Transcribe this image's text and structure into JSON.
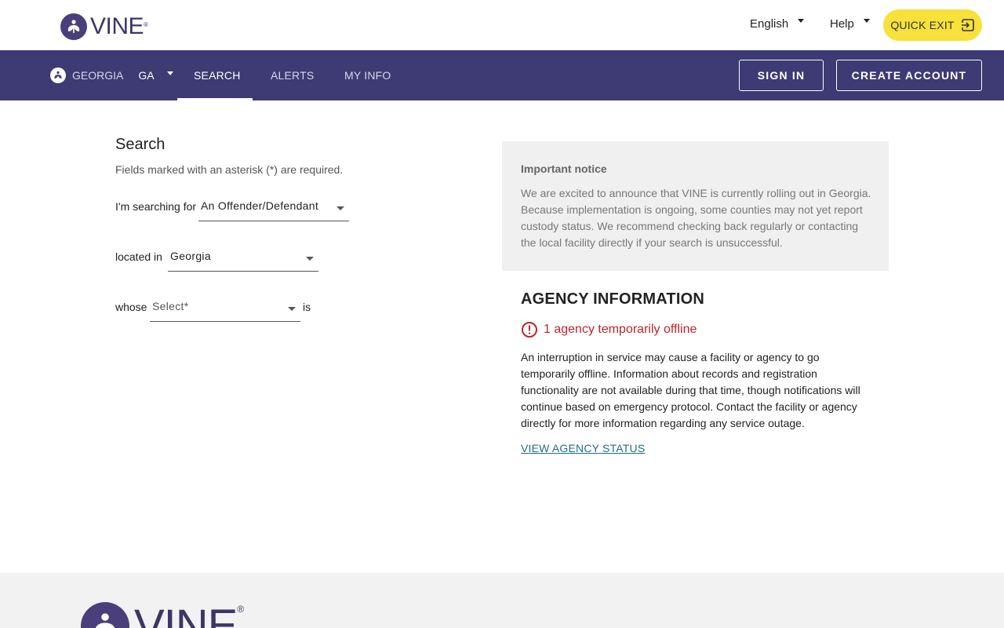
{
  "header": {
    "logo_text": "VINE",
    "logo_reg": "®",
    "language_label": "English",
    "help_label": "Help",
    "quick_exit_label": "QUICK EXIT"
  },
  "nav": {
    "state_name": "GEORGIA",
    "state_abbr": "GA",
    "links": [
      {
        "label": "SEARCH",
        "active": true
      },
      {
        "label": "ALERTS",
        "active": false
      },
      {
        "label": "MY INFO",
        "active": false
      }
    ],
    "sign_in_label": "SIGN IN",
    "create_account_label": "CREATE ACCOUNT"
  },
  "search": {
    "title": "Search",
    "required_note": "Fields marked with an asterisk (*) are required.",
    "searching_for_label": "I'm searching for",
    "searching_for_value": "An Offender/Defendant",
    "located_in_label": "located in",
    "located_in_value": "Georgia",
    "whose_label": "whose",
    "whose_placeholder": "Select*",
    "is_label": "is"
  },
  "notice": {
    "title": "Important notice",
    "body": "We are excited to announce that VINE is currently rolling out in Georgia. Because implementation is ongoing, some counties may not yet report custody status. We recommend checking back regularly or contacting the local facility directly if your search is unsuccessful."
  },
  "agency": {
    "title": "AGENCY INFORMATION",
    "offline_text": "1 agency temporarily offline",
    "body": "An interruption in service may cause a facility or agency to go temporarily offline. Information about records and registration functionality are not available during that time, though notifications will continue based on emergency protocol. Contact the facility or agency directly for more information regarding any service outage.",
    "link_label": "VIEW AGENCY STATUS"
  },
  "footer": {
    "logo_text": "VINE",
    "logo_reg": "®"
  },
  "colors": {
    "brand_purple": "#3e3a73",
    "quick_exit_yellow": "#f7e13a",
    "offline_red": "#c0242a",
    "link_teal": "#1f6f8b"
  },
  "icons": [
    "vine-logo-icon",
    "chevron-down-icon",
    "exit-icon",
    "state-seal-icon",
    "alert-circle-icon"
  ]
}
